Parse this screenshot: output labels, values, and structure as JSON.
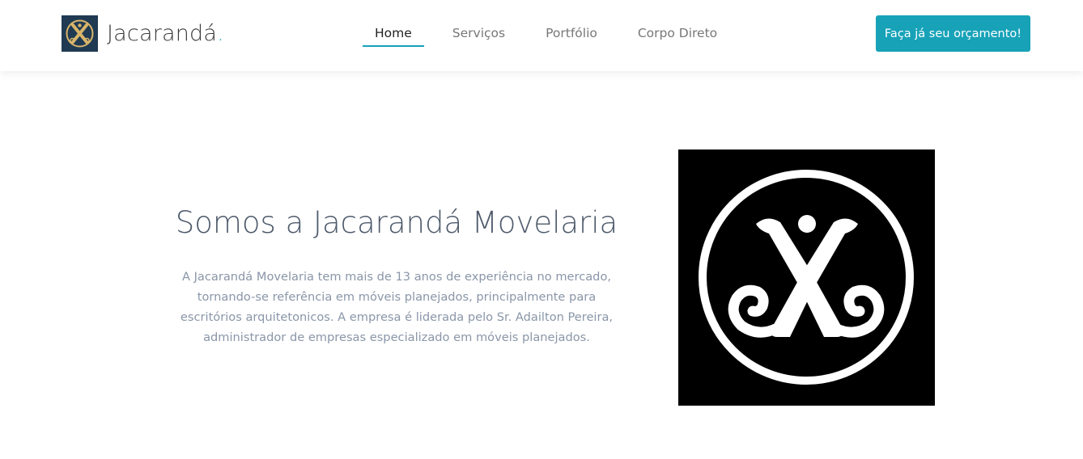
{
  "header": {
    "brand": {
      "name": "Jacarandá",
      "dot": ".",
      "logo_icon": "jacaranda-emblem-icon"
    },
    "nav": [
      {
        "label": "Home",
        "active": true
      },
      {
        "label": "Serviços",
        "active": false
      },
      {
        "label": "Portfólio",
        "active": false
      },
      {
        "label": "Corpo Direto",
        "active": false
      }
    ],
    "cta_label": "Faça já seu orçamento!"
  },
  "hero": {
    "title": "Somos a Jacarandá Movelaria",
    "text": "A Jacarandá Movelaria tem mais de 13 anos de experiência no mercado, tornando-se referência em móveis planejados, principalmente para escritórios arquitetonicos. A empresa é liderada pelo Sr. Adailton Pereira, administrador de empresas especializado em móveis planejados.",
    "image_icon": "jacaranda-emblem-icon"
  },
  "colors": {
    "accent": "#17a2b8",
    "logo_background": "#1f3a52",
    "logo_emblem": "#d8b46a",
    "title": "#4e5a6b",
    "body_text": "#8a96a8",
    "nav_text": "#777777",
    "nav_active": "#222222"
  }
}
